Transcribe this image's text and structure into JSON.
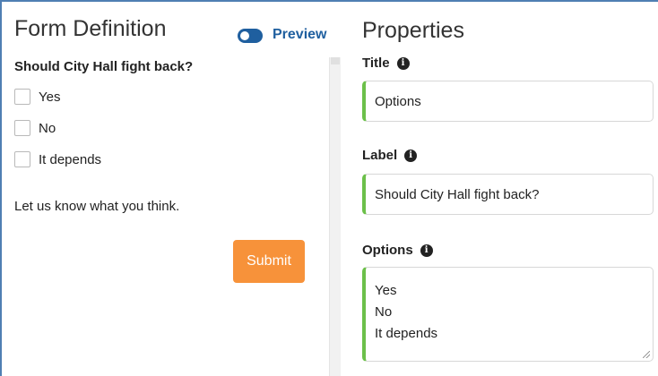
{
  "form_definition": {
    "title": "Form Definition",
    "preview_label": "Preview",
    "preview_enabled": true,
    "question": "Should City Hall fight back?",
    "options": [
      "Yes",
      "No",
      "It depends"
    ],
    "help_text": "Let us know what you think.",
    "submit_label": "Submit"
  },
  "properties": {
    "title": "Properties",
    "title_field": {
      "label": "Title",
      "value": "Options"
    },
    "label_field": {
      "label": "Label",
      "value": "Should City Hall fight back?"
    },
    "options_field": {
      "label": "Options",
      "values": [
        "Yes",
        "No",
        "It depends"
      ]
    }
  },
  "colors": {
    "accent_blue": "#1f5f9f",
    "submit_orange": "#f7923a",
    "field_green": "#6cc04a"
  },
  "icons": [
    "toggle-switch-icon",
    "info-icon",
    "resize-handle-icon"
  ]
}
